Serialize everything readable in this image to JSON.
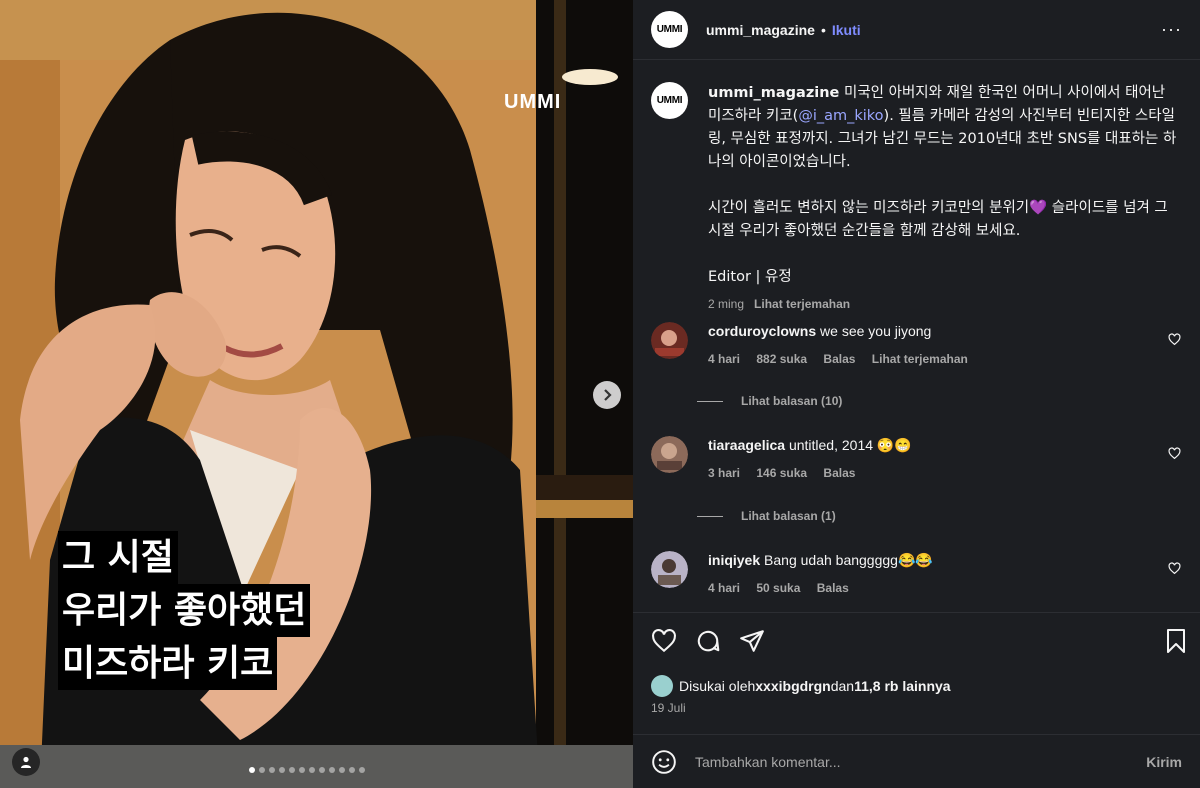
{
  "media": {
    "watermark": "UMMI",
    "overlay_lines": [
      "그 시절",
      "우리가 좋아했던",
      "미즈하라 키코"
    ],
    "slide_count": 12,
    "active_slide": 1
  },
  "header": {
    "avatar_text": "UMMI",
    "username": "ummi_magazine",
    "separator": "•",
    "follow_label": "Ikuti",
    "more_label": "···"
  },
  "post": {
    "username": "ummi_magazine",
    "text_before_mention": " 미국인 아버지와 재일 한국인 어머니 사이에서 태어난 미즈하라 키코(",
    "mention": "@i_am_kiko",
    "text_after_mention": "). 필름 카메라 감성의 사진부터 빈티지한 스타일링, 무심한 표정까지. 그녀가 남긴 무드는 2010년대 초반 SNS를 대표하는 하나의 아이콘이었습니다.",
    "paragraph2": "시간이 흘러도 변하지 않는 미즈하라 키코만의 분위기💜 슬라이드를 넘겨 그 시절 우리가 좋아했던 순간들을 함께 감상해 보세요.",
    "editor": "Editor | 유정",
    "time": "2 ming",
    "translate": "Lihat terjemahan"
  },
  "comments": [
    {
      "user": "corduroyclowns",
      "text": "we see you jiyong",
      "time": "4 hari",
      "likes": "882 suka",
      "reply": "Balas",
      "translate": "Lihat terjemahan",
      "replies": "Lihat balasan (10)"
    },
    {
      "user": "tiaraagelica",
      "text": "untitled, 2014 😳😁",
      "time": "3 hari",
      "likes": "146 suka",
      "reply": "Balas",
      "replies": "Lihat balasan (1)"
    },
    {
      "user": "iniqiyek",
      "text": "Bang udah banggggg😂😂",
      "time": "4 hari",
      "likes": "50 suka",
      "reply": "Balas"
    }
  ],
  "likes": {
    "prefix": "Disukai oleh ",
    "user": "xxxibgdrgn",
    "middle": " dan ",
    "others": "11,8 rb lainnya"
  },
  "date": "19 Juli",
  "composer": {
    "placeholder": "Tambahkan komentar...",
    "send_label": "Kirim"
  },
  "colors": {
    "panel_bg": "#1c1e22",
    "follow": "#7f8cff",
    "mention": "#9aa6ff",
    "muted": "#a8a8a8"
  }
}
